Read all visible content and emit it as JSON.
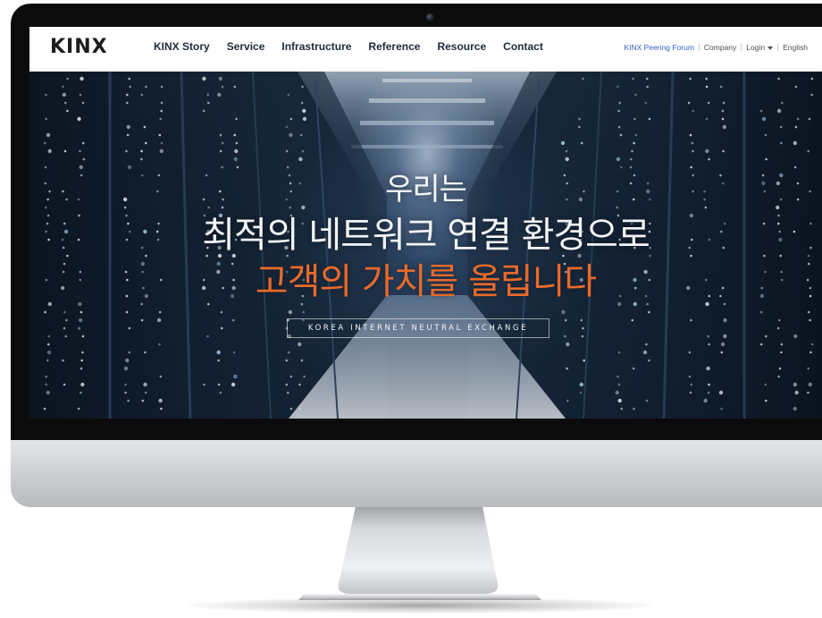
{
  "brand": {
    "logo_text": "KINX"
  },
  "nav": {
    "main_items": [
      {
        "label": "KINX Story"
      },
      {
        "label": "Service"
      },
      {
        "label": "Infrastructure"
      },
      {
        "label": "Reference"
      },
      {
        "label": "Resource"
      },
      {
        "label": "Contact"
      }
    ],
    "utility": {
      "peering_forum": "KINX Peering Forum",
      "company": "Company",
      "login": "Login",
      "language": "English"
    }
  },
  "hero": {
    "line1": "우리는",
    "line2": "최적의 네트워크 연결 환경으로",
    "line3": "고객의 가치를 올립니다",
    "tagline": "KOREA INTERNET NEUTRAL EXCHANGE"
  },
  "colors": {
    "accent_orange": "#e86a2a",
    "link_blue": "#3560c4",
    "nav_text": "#1f2a3a",
    "bezel": "#0b0b0c",
    "aluminum": "#c9cbce"
  },
  "icons": {
    "login_caret": "chevron-down-icon",
    "camera": "camera-icon"
  }
}
